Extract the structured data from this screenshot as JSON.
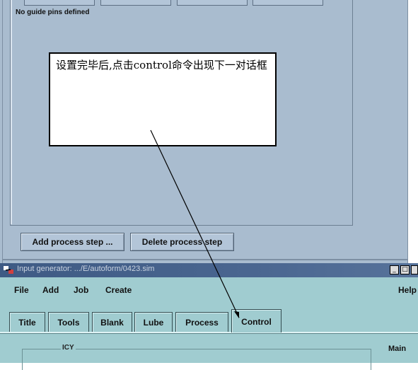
{
  "top_window": {
    "note": "No guide pins defined",
    "buttons": {
      "add_step": "Add process step ...",
      "delete_step": "Delete process step"
    },
    "colors": {
      "background": "#a9bccf",
      "button": "#b3c5d8"
    }
  },
  "callout": {
    "text": "设置完毕后,点击control命令出现下一对话框"
  },
  "input_generator": {
    "title": "Input generator: .../E/autoform/0423.sim",
    "menu": [
      "File",
      "Add",
      "Job",
      "Create",
      "Help"
    ],
    "tabs": [
      {
        "label": "Title"
      },
      {
        "label": "Tools"
      },
      {
        "label": "Blank"
      },
      {
        "label": "Lube"
      },
      {
        "label": "Process"
      },
      {
        "label": "Control"
      }
    ],
    "active_tab": "Control",
    "group_label": "ICY",
    "right_label": "Main",
    "colors": {
      "body": "#a0ccd0",
      "titlebar": "#3e5a84"
    }
  }
}
